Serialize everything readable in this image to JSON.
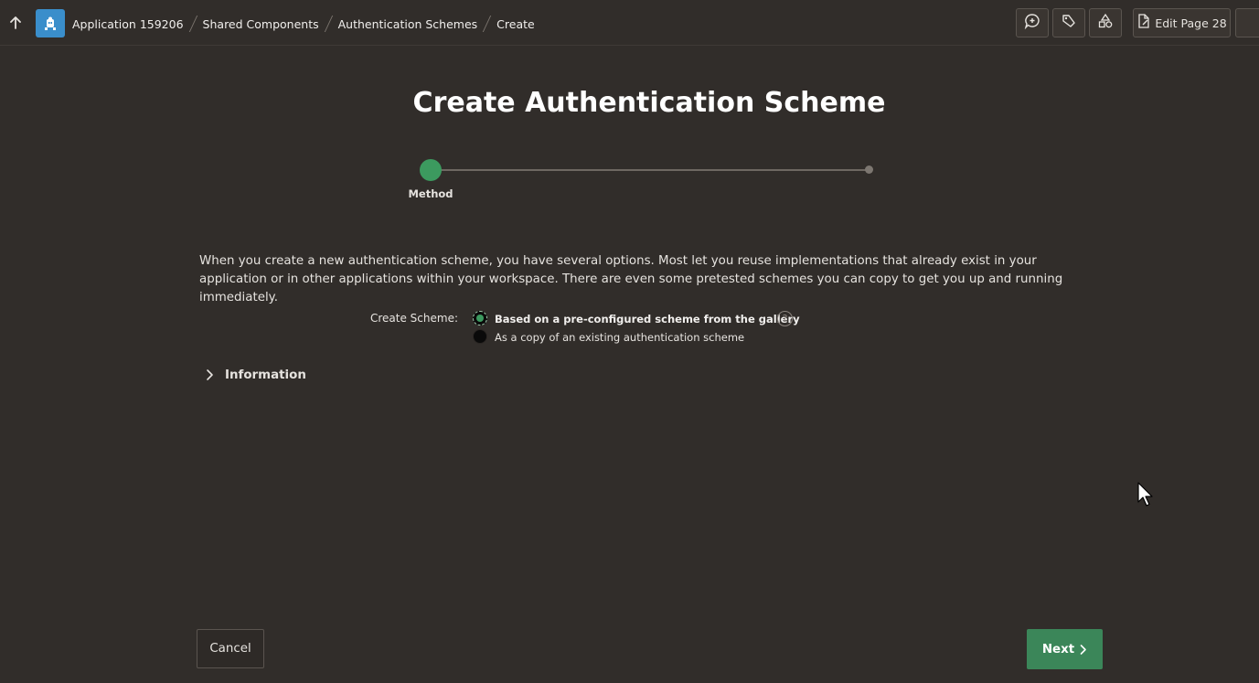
{
  "header": {
    "breadcrumb": [
      "Application 159206",
      "Shared Components",
      "Authentication Schemes",
      "Create"
    ],
    "edit_page_label": "Edit Page 28",
    "icons": [
      "up-arrow-icon",
      "app-icon",
      "comment-icon",
      "tag-icon",
      "shapes-icon",
      "edit-page-icon"
    ]
  },
  "wizard": {
    "title": "Create Authentication Scheme",
    "steps": [
      "Method"
    ],
    "active_step": 0
  },
  "intro_text": "When you create a new authentication scheme, you have several options. Most let you reuse implementations that already exist in your application or in other applications within your workspace. There are even some pretested schemes you can copy to get you up and running immediately.",
  "create_scheme": {
    "label": "Create Scheme:",
    "options": [
      "Based on a pre-configured scheme from the gallery",
      "As a copy of an existing authentication scheme"
    ],
    "selected": 0,
    "help_glyph": "?"
  },
  "information_label": "Information",
  "buttons": {
    "cancel": "Cancel",
    "next": "Next"
  },
  "colors": {
    "background": "#312d2a",
    "accent_green": "#3b8659",
    "app_icon_blue": "#3a8ecb"
  }
}
